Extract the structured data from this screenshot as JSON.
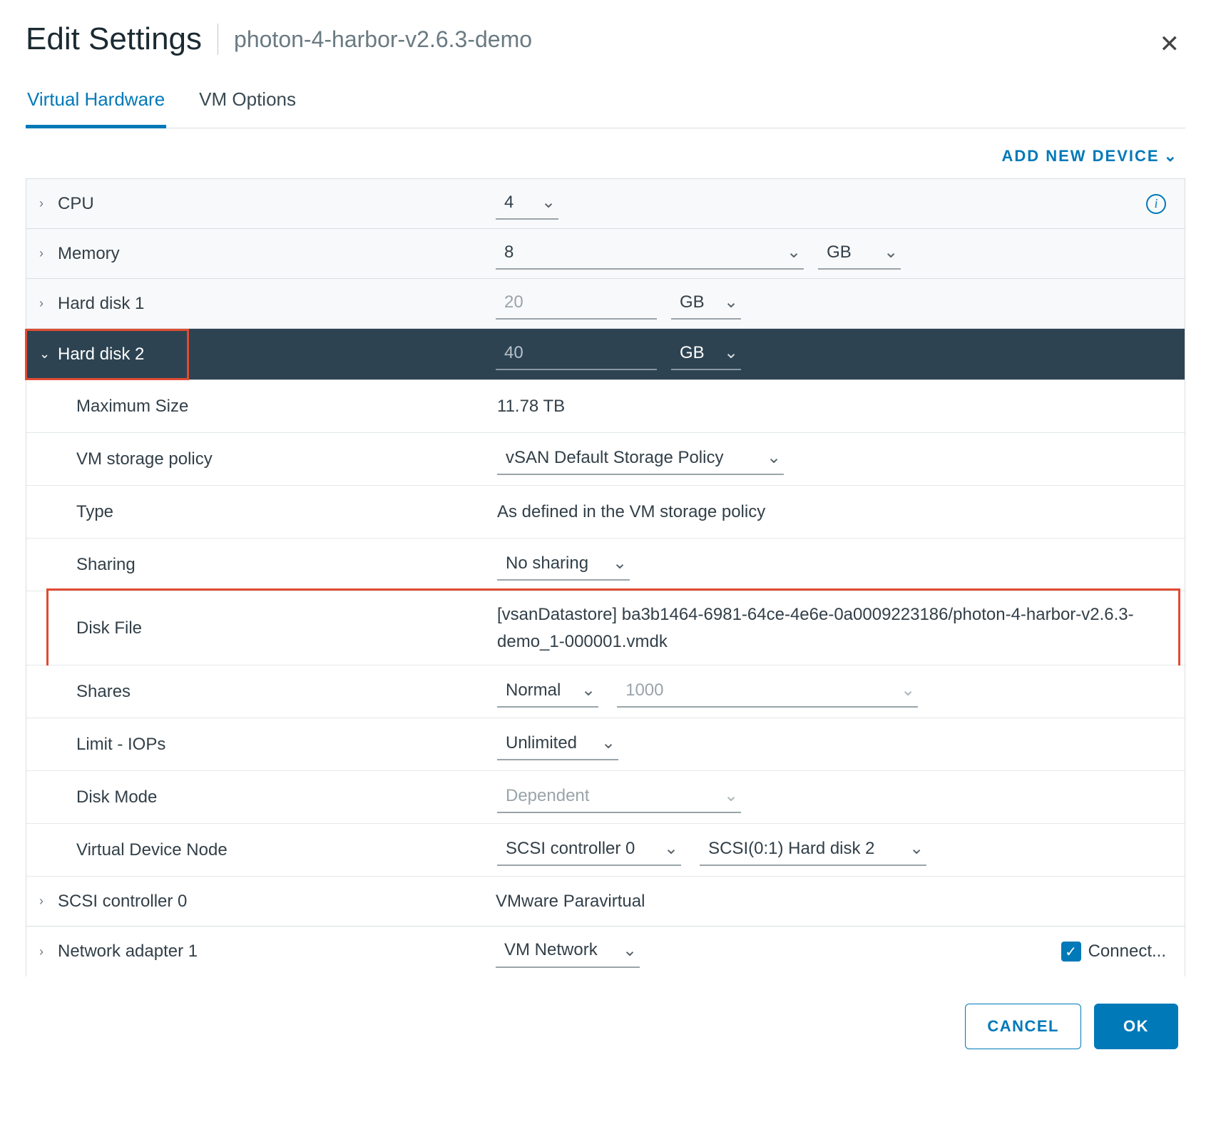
{
  "dialog": {
    "title": "Edit Settings",
    "vm_name": "photon-4-harbor-v2.6.3-demo"
  },
  "tabs": {
    "hardware": "Virtual Hardware",
    "options": "VM Options"
  },
  "add_device": "ADD NEW DEVICE",
  "rows": {
    "cpu": {
      "label": "CPU",
      "value": "4"
    },
    "memory": {
      "label": "Memory",
      "value": "8",
      "unit": "GB"
    },
    "hd1": {
      "label": "Hard disk 1",
      "value": "20",
      "unit": "GB"
    },
    "hd2": {
      "label": "Hard disk 2",
      "value": "40",
      "unit": "GB"
    },
    "scsi0": {
      "label": "SCSI controller 0",
      "value": "VMware Paravirtual"
    },
    "net1": {
      "label": "Network adapter 1",
      "value": "VM Network",
      "connect": "Connect..."
    }
  },
  "hd2_details": {
    "max_size": {
      "label": "Maximum Size",
      "value": "11.78 TB"
    },
    "policy": {
      "label": "VM storage policy",
      "value": "vSAN Default Storage Policy"
    },
    "type": {
      "label": "Type",
      "value": "As defined in the VM storage policy"
    },
    "sharing": {
      "label": "Sharing",
      "value": "No sharing"
    },
    "disk_file": {
      "label": "Disk File",
      "value": "[vsanDatastore] ba3b1464-6981-64ce-4e6e-0a0009223186/photon-4-harbor-v2.6.3-demo_1-000001.vmdk"
    },
    "shares": {
      "label": "Shares",
      "level": "Normal",
      "value": "1000"
    },
    "limit": {
      "label": "Limit - IOPs",
      "value": "Unlimited"
    },
    "mode": {
      "label": "Disk Mode",
      "value": "Dependent"
    },
    "node": {
      "label": "Virtual Device Node",
      "controller": "SCSI controller 0",
      "slot": "SCSI(0:1) Hard disk 2"
    }
  },
  "footer": {
    "cancel": "CANCEL",
    "ok": "OK"
  }
}
